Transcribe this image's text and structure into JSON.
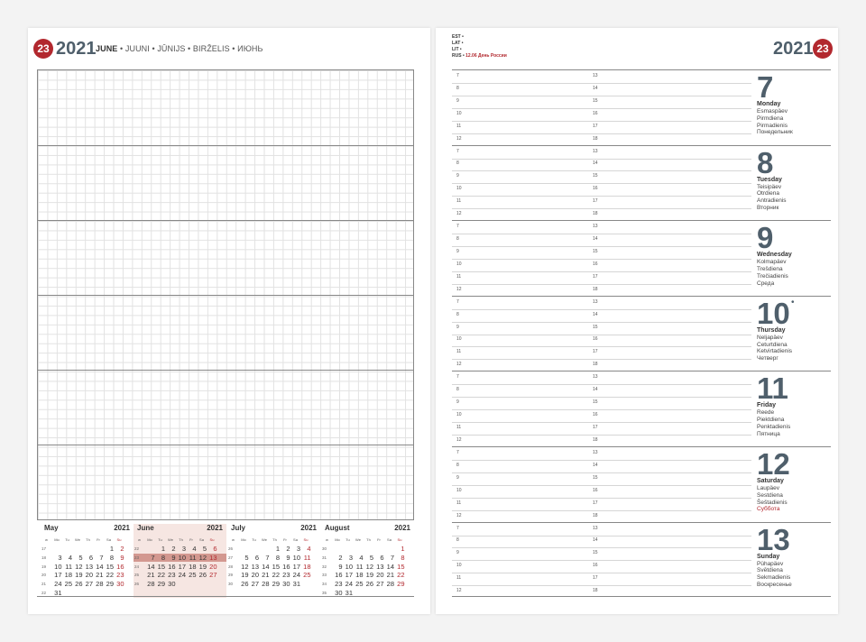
{
  "left_page": {
    "week_number": "23",
    "year": "2021",
    "month_title": "JUNE",
    "month_translations": [
      "JUUNI",
      "JŪNIJS",
      "BIRŽELIS",
      "ИЮНЬ"
    ],
    "mini_calendars": [
      {
        "name": "May",
        "year": "2021",
        "weekdays": [
          "w",
          "Mo",
          "Tu",
          "We",
          "Th",
          "Fr",
          "Sa",
          "Su"
        ],
        "weeks": [
          {
            "wk": "17",
            "days": [
              "",
              "",
              "",
              "",
              "",
              "1",
              "2"
            ]
          },
          {
            "wk": "18",
            "days": [
              "3",
              "4",
              "5",
              "6",
              "7",
              "8",
              "9"
            ]
          },
          {
            "wk": "19",
            "days": [
              "10",
              "11",
              "12",
              "13",
              "14",
              "15",
              "16"
            ]
          },
          {
            "wk": "20",
            "days": [
              "17",
              "18",
              "19",
              "20",
              "21",
              "22",
              "23"
            ]
          },
          {
            "wk": "21",
            "days": [
              "24",
              "25",
              "26",
              "27",
              "28",
              "29",
              "30"
            ]
          },
          {
            "wk": "22",
            "days": [
              "31",
              "",
              "",
              "",
              "",
              "",
              ""
            ]
          }
        ]
      },
      {
        "name": "June",
        "year": "2021",
        "weekdays": [
          "w",
          "Mo",
          "Tu",
          "We",
          "Th",
          "Fr",
          "Sa",
          "Su"
        ],
        "weeks": [
          {
            "wk": "22",
            "days": [
              "",
              "1",
              "2",
              "3",
              "4",
              "5",
              "6"
            ]
          },
          {
            "wk": "23",
            "days": [
              "7",
              "8",
              "9",
              "10",
              "11",
              "12",
              "13"
            ]
          },
          {
            "wk": "24",
            "days": [
              "14",
              "15",
              "16",
              "17",
              "18",
              "19",
              "20"
            ]
          },
          {
            "wk": "25",
            "days": [
              "21",
              "22",
              "23",
              "24",
              "25",
              "26",
              "27"
            ]
          },
          {
            "wk": "26",
            "days": [
              "28",
              "29",
              "30",
              "",
              "",
              "",
              ""
            ]
          }
        ]
      },
      {
        "name": "July",
        "year": "2021",
        "weekdays": [
          "w",
          "Mo",
          "Tu",
          "We",
          "Th",
          "Fr",
          "Sa",
          "Su"
        ],
        "weeks": [
          {
            "wk": "26",
            "days": [
              "",
              "",
              "",
              "1",
              "2",
              "3",
              "4"
            ]
          },
          {
            "wk": "27",
            "days": [
              "5",
              "6",
              "7",
              "8",
              "9",
              "10",
              "11"
            ]
          },
          {
            "wk": "28",
            "days": [
              "12",
              "13",
              "14",
              "15",
              "16",
              "17",
              "18"
            ]
          },
          {
            "wk": "29",
            "days": [
              "19",
              "20",
              "21",
              "22",
              "23",
              "24",
              "25"
            ]
          },
          {
            "wk": "30",
            "days": [
              "26",
              "27",
              "28",
              "29",
              "30",
              "31",
              ""
            ]
          }
        ]
      },
      {
        "name": "August",
        "year": "2021",
        "weekdays": [
          "w",
          "Mo",
          "Tu",
          "We",
          "Th",
          "Fr",
          "Sa",
          "Su"
        ],
        "weeks": [
          {
            "wk": "30",
            "days": [
              "",
              "",
              "",
              "",
              "",
              "",
              "1"
            ]
          },
          {
            "wk": "31",
            "days": [
              "2",
              "3",
              "4",
              "5",
              "6",
              "7",
              "8"
            ]
          },
          {
            "wk": "32",
            "days": [
              "9",
              "10",
              "11",
              "12",
              "13",
              "14",
              "15"
            ]
          },
          {
            "wk": "33",
            "days": [
              "16",
              "17",
              "18",
              "19",
              "20",
              "21",
              "22"
            ]
          },
          {
            "wk": "34",
            "days": [
              "23",
              "24",
              "25",
              "26",
              "27",
              "28",
              "29"
            ]
          },
          {
            "wk": "35",
            "days": [
              "30",
              "31",
              "",
              "",
              "",
              "",
              ""
            ]
          }
        ]
      }
    ]
  },
  "right_page": {
    "year": "2021",
    "week_number": "23",
    "holidays": [
      {
        "country": "EST",
        "note": ""
      },
      {
        "country": "LAT",
        "note": ""
      },
      {
        "country": "LIT",
        "note": ""
      },
      {
        "country": "RUS",
        "note": "12.06 День России"
      }
    ],
    "hours_left": [
      "7",
      "8",
      "9",
      "10",
      "11",
      "12"
    ],
    "hours_right": [
      "13",
      "14",
      "15",
      "16",
      "17",
      "18"
    ],
    "days": [
      {
        "num": "7",
        "name": "Monday",
        "langs": [
          "Esmaspäev",
          "Pirmdiena",
          "Pirmadienis",
          "Понедельник"
        ],
        "red_last": false,
        "dot": false
      },
      {
        "num": "8",
        "name": "Tuesday",
        "langs": [
          "Teisipäev",
          "Otrdiena",
          "Antradienis",
          "Вторник"
        ],
        "red_last": false,
        "dot": false
      },
      {
        "num": "9",
        "name": "Wednesday",
        "langs": [
          "Kolmapäev",
          "Trešdiena",
          "Trečiadienis",
          "Среда"
        ],
        "red_last": false,
        "dot": false
      },
      {
        "num": "10",
        "name": "Thursday",
        "langs": [
          "Neljapäev",
          "Ceturtdiena",
          "Ketvirtadienis",
          "Четверг"
        ],
        "red_last": false,
        "dot": true
      },
      {
        "num": "11",
        "name": "Friday",
        "langs": [
          "Reede",
          "Piektdiena",
          "Penktadienis",
          "Пятница"
        ],
        "red_last": false,
        "dot": false
      },
      {
        "num": "12",
        "name": "Saturday",
        "langs": [
          "Laupäev",
          "Sestdiena",
          "Šeštadienis",
          "Суббота"
        ],
        "red_last": true,
        "dot": false
      },
      {
        "num": "13",
        "name": "Sunday",
        "langs": [
          "Pühapäev",
          "Svētdiena",
          "Sekmadienis",
          "Воскресенье"
        ],
        "red_last": false,
        "dot": false
      }
    ]
  }
}
